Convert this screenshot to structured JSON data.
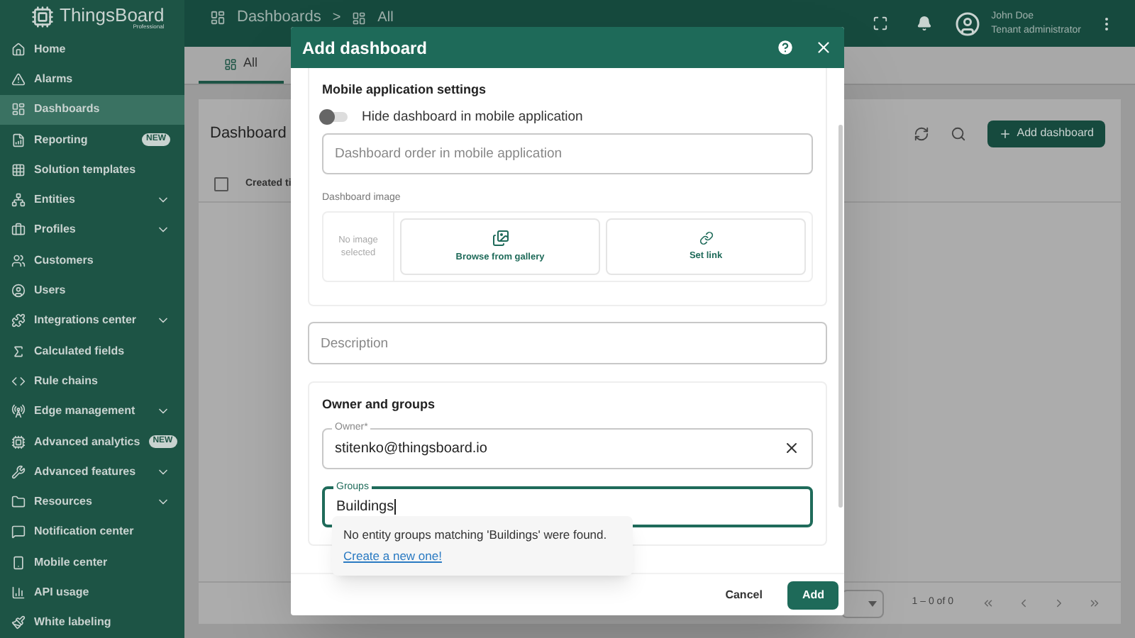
{
  "app": {
    "name": "ThingsBoard",
    "edition": "Professional"
  },
  "breadcrumb": [
    "Dashboards",
    ">",
    "All"
  ],
  "user": {
    "name": "John Doe",
    "role": "Tenant administrator"
  },
  "sidebar": {
    "items": [
      {
        "label": "Home",
        "selected": false,
        "expandable": false
      },
      {
        "label": "Alarms",
        "selected": false,
        "expandable": false
      },
      {
        "label": "Dashboards",
        "selected": true,
        "expandable": false
      },
      {
        "label": "Reporting",
        "selected": false,
        "badge": "NEW",
        "expandable": false
      },
      {
        "label": "Solution templates",
        "selected": false,
        "expandable": false
      },
      {
        "label": "Entities",
        "selected": false,
        "expandable": true
      },
      {
        "label": "Profiles",
        "selected": false,
        "expandable": true
      },
      {
        "label": "Customers",
        "selected": false,
        "expandable": false
      },
      {
        "label": "Users",
        "selected": false,
        "expandable": false
      },
      {
        "label": "Integrations center",
        "selected": false,
        "expandable": true
      },
      {
        "label": "Calculated fields",
        "selected": false,
        "expandable": false
      },
      {
        "label": "Rule chains",
        "selected": false,
        "expandable": false
      },
      {
        "label": "Edge management",
        "selected": false,
        "expandable": true
      },
      {
        "label": "Advanced analytics",
        "selected": false,
        "badge": "NEW",
        "expandable": false
      },
      {
        "label": "Advanced features",
        "selected": false,
        "expandable": true
      },
      {
        "label": "Resources",
        "selected": false,
        "expandable": true
      },
      {
        "label": "Notification center",
        "selected": false,
        "expandable": false
      },
      {
        "label": "Mobile center",
        "selected": false,
        "expandable": false
      },
      {
        "label": "API usage",
        "selected": false,
        "expandable": false
      },
      {
        "label": "White labeling",
        "selected": false,
        "expandable": false
      }
    ]
  },
  "tabs": [
    {
      "label": "All",
      "selected": true
    }
  ],
  "card": {
    "title": "Dashboard",
    "select_all": {
      "checked": false
    },
    "add_button": "Add dashboard",
    "columns": [
      "Created ti"
    ],
    "pagination": "1 – 0 of 0"
  },
  "dialog": {
    "title": "Add dashboard",
    "mobile": {
      "title": "Mobile application settings",
      "toggle": {
        "label": "Hide dashboard in mobile application",
        "on": false
      },
      "order_field": {
        "placeholder": "Dashboard order in mobile application"
      },
      "image_label": "Dashboard image",
      "no_image": "No image selected",
      "gallery": "Browse from gallery",
      "link": "Set link"
    },
    "description": {
      "placeholder": "Description"
    },
    "owner_groups": {
      "title": "Owner and groups",
      "owner": {
        "label": "Owner*",
        "value": "stitenko@thingsboard.io",
        "focused": false
      },
      "groups": {
        "label": "Groups",
        "value": "Buildings",
        "focused": true
      }
    },
    "popup": {
      "message": "No entity groups matching 'Buildings' were found.",
      "link": "Create a new one!"
    },
    "buttons": {
      "cancel": "Cancel",
      "add": "Add"
    }
  }
}
